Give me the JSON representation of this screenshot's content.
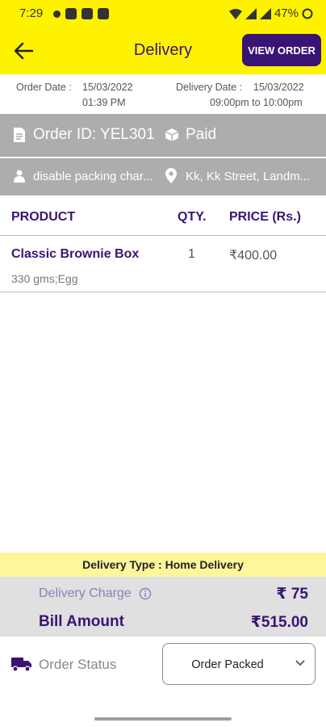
{
  "status_bar": {
    "time": "7:29",
    "battery": "47%"
  },
  "app_bar": {
    "title": "Delivery",
    "view_order_label": "VIEW ORDER"
  },
  "dates": {
    "order_label": "Order Date :",
    "order_date": "15/03/2022",
    "order_time": "01:39 PM",
    "delivery_label": "Delivery Date :",
    "delivery_date": "15/03/2022",
    "delivery_window": "09:00pm to 10:00pm"
  },
  "order_info": {
    "order_id": "Order ID: YEL301",
    "payment_status": "Paid",
    "note": "disable packing char...",
    "address": "Kk, Kk Street, Landm..."
  },
  "table": {
    "headers": {
      "product": "PRODUCT",
      "qty": "QTY.",
      "price": "PRICE (Rs.)"
    },
    "items": [
      {
        "name": "Classic Brownie Box",
        "desc": "330 gms;Egg",
        "qty": "1",
        "price": "₹400.00"
      }
    ]
  },
  "summary": {
    "delivery_type": "Delivery Type : Home Delivery",
    "delivery_charge_label": "Delivery Charge",
    "delivery_charge_value": "₹ 75",
    "bill_amount_label": "Bill Amount",
    "bill_amount_value": "₹515.00"
  },
  "order_status": {
    "label": "Order Status",
    "selected": "Order Packed"
  },
  "colors": {
    "accent_yellow": "#fff200",
    "brand_purple": "#3a1474",
    "info_grey": "#adadad"
  }
}
